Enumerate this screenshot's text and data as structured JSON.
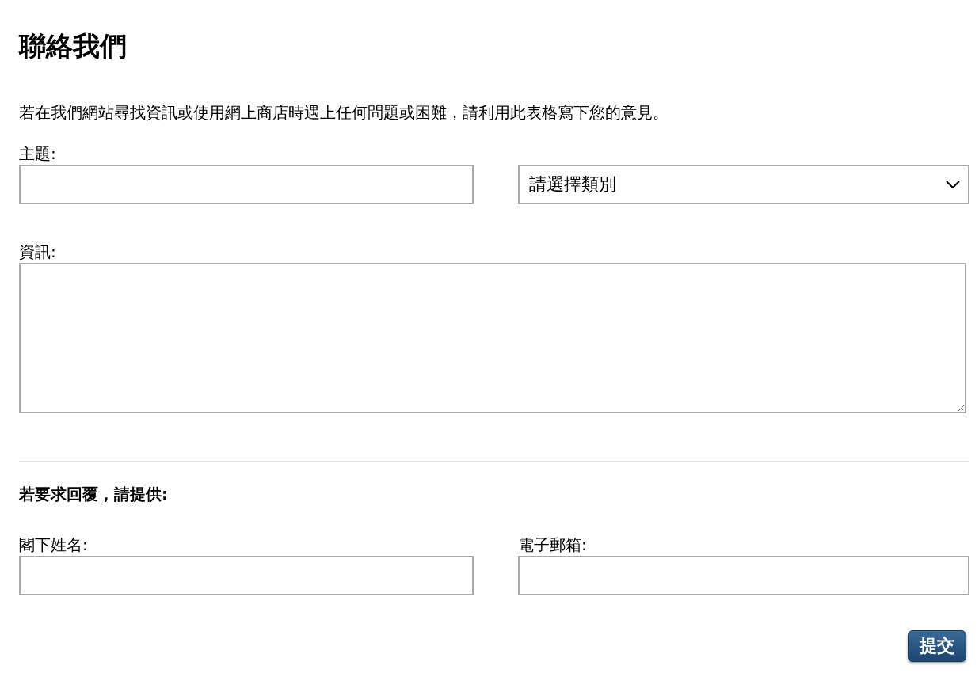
{
  "title": "聯絡我們",
  "intro": "若在我們網站尋找資訊或使用網上商店時遇上任何問題或困難，請利用此表格寫下您的意見。",
  "subject": {
    "label": "主題:"
  },
  "category_select": {
    "value": "請選擇類別"
  },
  "message": {
    "label": "資訊:"
  },
  "reply_heading": "若要求回覆，請提供:",
  "name": {
    "label": "閣下姓名:"
  },
  "email": {
    "label": "電子郵箱:"
  },
  "submit": "提交"
}
